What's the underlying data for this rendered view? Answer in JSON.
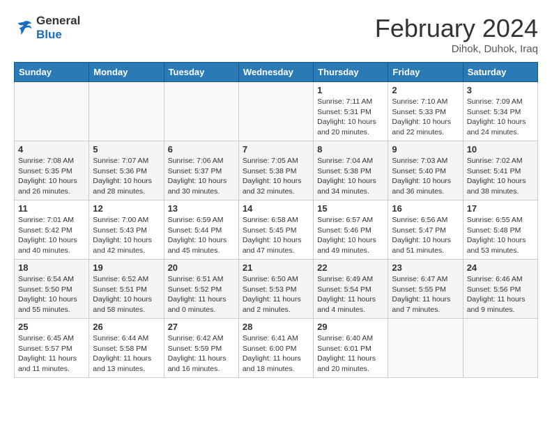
{
  "header": {
    "logo_general": "General",
    "logo_blue": "Blue",
    "month_title": "February 2024",
    "location": "Dihok, Duhok, Iraq"
  },
  "weekdays": [
    "Sunday",
    "Monday",
    "Tuesday",
    "Wednesday",
    "Thursday",
    "Friday",
    "Saturday"
  ],
  "weeks": [
    [
      {
        "day": "",
        "info": ""
      },
      {
        "day": "",
        "info": ""
      },
      {
        "day": "",
        "info": ""
      },
      {
        "day": "",
        "info": ""
      },
      {
        "day": "1",
        "info": "Sunrise: 7:11 AM\nSunset: 5:31 PM\nDaylight: 10 hours\nand 20 minutes."
      },
      {
        "day": "2",
        "info": "Sunrise: 7:10 AM\nSunset: 5:33 PM\nDaylight: 10 hours\nand 22 minutes."
      },
      {
        "day": "3",
        "info": "Sunrise: 7:09 AM\nSunset: 5:34 PM\nDaylight: 10 hours\nand 24 minutes."
      }
    ],
    [
      {
        "day": "4",
        "info": "Sunrise: 7:08 AM\nSunset: 5:35 PM\nDaylight: 10 hours\nand 26 minutes."
      },
      {
        "day": "5",
        "info": "Sunrise: 7:07 AM\nSunset: 5:36 PM\nDaylight: 10 hours\nand 28 minutes."
      },
      {
        "day": "6",
        "info": "Sunrise: 7:06 AM\nSunset: 5:37 PM\nDaylight: 10 hours\nand 30 minutes."
      },
      {
        "day": "7",
        "info": "Sunrise: 7:05 AM\nSunset: 5:38 PM\nDaylight: 10 hours\nand 32 minutes."
      },
      {
        "day": "8",
        "info": "Sunrise: 7:04 AM\nSunset: 5:38 PM\nDaylight: 10 hours\nand 34 minutes."
      },
      {
        "day": "9",
        "info": "Sunrise: 7:03 AM\nSunset: 5:40 PM\nDaylight: 10 hours\nand 36 minutes."
      },
      {
        "day": "10",
        "info": "Sunrise: 7:02 AM\nSunset: 5:41 PM\nDaylight: 10 hours\nand 38 minutes."
      }
    ],
    [
      {
        "day": "11",
        "info": "Sunrise: 7:01 AM\nSunset: 5:42 PM\nDaylight: 10 hours\nand 40 minutes."
      },
      {
        "day": "12",
        "info": "Sunrise: 7:00 AM\nSunset: 5:43 PM\nDaylight: 10 hours\nand 42 minutes."
      },
      {
        "day": "13",
        "info": "Sunrise: 6:59 AM\nSunset: 5:44 PM\nDaylight: 10 hours\nand 45 minutes."
      },
      {
        "day": "14",
        "info": "Sunrise: 6:58 AM\nSunset: 5:45 PM\nDaylight: 10 hours\nand 47 minutes."
      },
      {
        "day": "15",
        "info": "Sunrise: 6:57 AM\nSunset: 5:46 PM\nDaylight: 10 hours\nand 49 minutes."
      },
      {
        "day": "16",
        "info": "Sunrise: 6:56 AM\nSunset: 5:47 PM\nDaylight: 10 hours\nand 51 minutes."
      },
      {
        "day": "17",
        "info": "Sunrise: 6:55 AM\nSunset: 5:48 PM\nDaylight: 10 hours\nand 53 minutes."
      }
    ],
    [
      {
        "day": "18",
        "info": "Sunrise: 6:54 AM\nSunset: 5:50 PM\nDaylight: 10 hours\nand 55 minutes."
      },
      {
        "day": "19",
        "info": "Sunrise: 6:52 AM\nSunset: 5:51 PM\nDaylight: 10 hours\nand 58 minutes."
      },
      {
        "day": "20",
        "info": "Sunrise: 6:51 AM\nSunset: 5:52 PM\nDaylight: 11 hours\nand 0 minutes."
      },
      {
        "day": "21",
        "info": "Sunrise: 6:50 AM\nSunset: 5:53 PM\nDaylight: 11 hours\nand 2 minutes."
      },
      {
        "day": "22",
        "info": "Sunrise: 6:49 AM\nSunset: 5:54 PM\nDaylight: 11 hours\nand 4 minutes."
      },
      {
        "day": "23",
        "info": "Sunrise: 6:47 AM\nSunset: 5:55 PM\nDaylight: 11 hours\nand 7 minutes."
      },
      {
        "day": "24",
        "info": "Sunrise: 6:46 AM\nSunset: 5:56 PM\nDaylight: 11 hours\nand 9 minutes."
      }
    ],
    [
      {
        "day": "25",
        "info": "Sunrise: 6:45 AM\nSunset: 5:57 PM\nDaylight: 11 hours\nand 11 minutes."
      },
      {
        "day": "26",
        "info": "Sunrise: 6:44 AM\nSunset: 5:58 PM\nDaylight: 11 hours\nand 13 minutes."
      },
      {
        "day": "27",
        "info": "Sunrise: 6:42 AM\nSunset: 5:59 PM\nDaylight: 11 hours\nand 16 minutes."
      },
      {
        "day": "28",
        "info": "Sunrise: 6:41 AM\nSunset: 6:00 PM\nDaylight: 11 hours\nand 18 minutes."
      },
      {
        "day": "29",
        "info": "Sunrise: 6:40 AM\nSunset: 6:01 PM\nDaylight: 11 hours\nand 20 minutes."
      },
      {
        "day": "",
        "info": ""
      },
      {
        "day": "",
        "info": ""
      }
    ]
  ]
}
